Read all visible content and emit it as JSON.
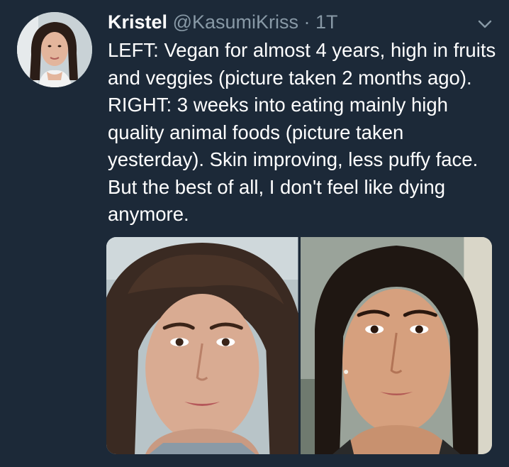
{
  "tweet": {
    "display_name": "Kristel",
    "handle": "@KasumiKriss",
    "separator": " · ",
    "time": "1T",
    "text": "LEFT: Vegan for almost 4 years, high in fruits and veggies (picture taken 2 months ago). RIGHT: 3 weeks into eating mainly high quality animal foods (picture taken yesterday). Skin improving, less puffy face. But the best of all, I don't feel like dying anymore."
  },
  "media": {
    "left_photo": "portrait-before",
    "right_photo": "portrait-after"
  },
  "icons": {
    "menu": "chevron-down-icon"
  },
  "colors": {
    "background": "#1c2938",
    "text": "#ffffff",
    "secondary_text": "#8899a6"
  }
}
